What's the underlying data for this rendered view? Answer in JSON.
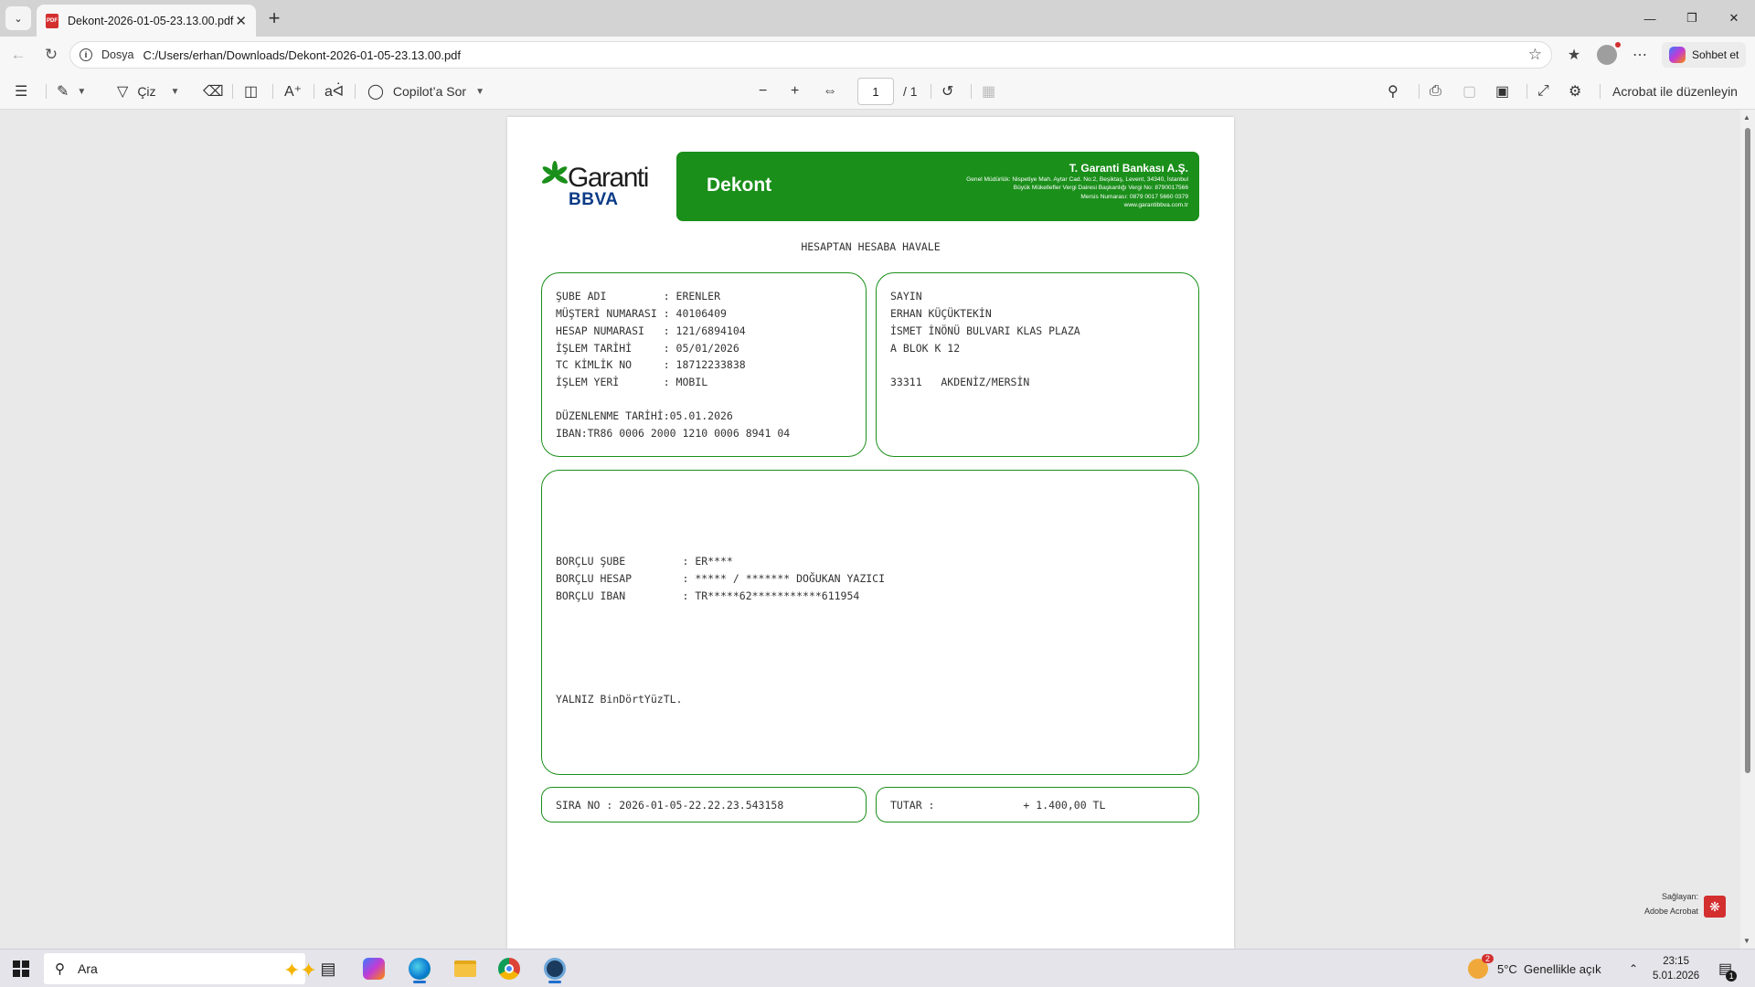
{
  "browser": {
    "tab_title": "Dekont-2026-01-05-23.13.00.pdf",
    "scheme_label": "Dosya",
    "url": "C:/Users/erhan/Downloads/Dekont-2026-01-05-23.13.00.pdf",
    "chat_label": "Sohbet et"
  },
  "toolbar": {
    "draw_label": "Çiz",
    "copilot_label": "Copilot’a Sor",
    "page_current": "1",
    "page_total": "/ 1",
    "acrobat_edit_label": "Acrobat ile düzenleyin"
  },
  "document": {
    "brand_top": "Garanti",
    "brand_bottom": "BBVA",
    "banner_title": "Dekont",
    "bank_name": "T. Garanti Bankası A.Ş.",
    "bank_address_lines": [
      "Genel Müdürlük: Nispetiye Mah. Aytar Cad. No:2, Beşiktaş, Levent, 34340, İstanbul",
      "Büyük Mükellefler Vergi Dairesi Başkanlığı Vergi No: 8790017566",
      "Mersis Numarası: 0879 0017 5660 0379",
      "www.garantibbva.com.tr"
    ],
    "doc_title": "HESAPTAN HESABA HAVALE",
    "left_box": {
      "rows": [
        "ŞUBE ADI         : ERENLER",
        "MÜŞTERİ NUMARASI : 40106409",
        "HESAP NUMARASI   : 121/6894104",
        "İŞLEM TARİHİ     : 05/01/2026",
        "TC KİMLİK NO     : 18712233838",
        "İŞLEM YERİ       : MOBIL"
      ],
      "issue_date": "DÜZENLENME TARİHİ:05.01.2026",
      "iban": "IBAN:TR86 0006 2000 1210 0006 8941 04"
    },
    "right_box": {
      "greeting": "SAYIN",
      "name": "ERHAN KÜÇÜKTEKİN",
      "address1": "İSMET İNÖNÜ BULVARI KLAS PLAZA",
      "address2": "A BLOK K 12",
      "postal": "33311   AKDENİZ/MERSİN"
    },
    "middle_box": {
      "rows": [
        "BORÇLU ŞUBE         : ER****",
        "BORÇLU HESAP        : ***** / ******* DOĞUKAN YAZICI",
        "BORÇLU IBAN         : TR*****62***********611954"
      ],
      "amount_words": "YALNIZ BinDörtYüzTL."
    },
    "sequence": "SIRA NO : 2026-01-05-22.22.23.543158",
    "total": "TUTAR :              + 1.400,00 TL"
  },
  "acrobat_badge": {
    "line1": "Sağlayan:",
    "line2": "Adobe Acrobat"
  },
  "taskbar": {
    "search_placeholder": "Ara",
    "weather": "5°C  Genellikle açık",
    "weather_badge": "2",
    "time": "23:15",
    "date": "5.01.2026",
    "notification_count": "1"
  }
}
